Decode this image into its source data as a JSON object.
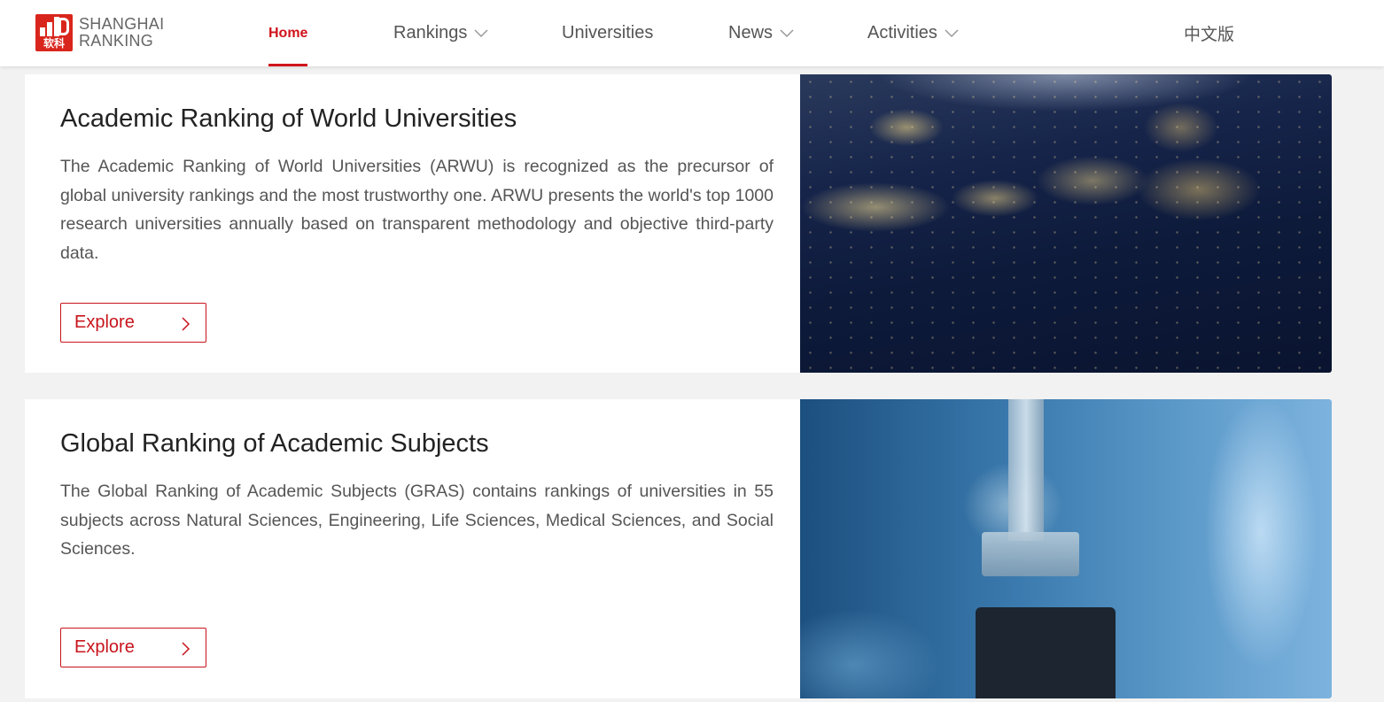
{
  "header": {
    "logo": {
      "line1": "SHANGHAI",
      "line2": "RANKING",
      "mark_text": "软科"
    },
    "nav": [
      {
        "label": "Home",
        "active": true,
        "has_dropdown": false
      },
      {
        "label": "Rankings",
        "active": false,
        "has_dropdown": true
      },
      {
        "label": "Universities",
        "active": false,
        "has_dropdown": false
      },
      {
        "label": "News",
        "active": false,
        "has_dropdown": true
      },
      {
        "label": "Activities",
        "active": false,
        "has_dropdown": true
      }
    ],
    "language": "中文版"
  },
  "cards": [
    {
      "title": "Academic Ranking of World Universities",
      "description": "The Academic Ranking of World Universities (ARWU) is recognized as the precursor of global university rankings and the most trustworthy one. ARWU presents the world's top 1000 research universities annually based on transparent methodology and objective third-party data.",
      "button": "Explore",
      "image": "earth-at-night-image"
    },
    {
      "title": "Global Ranking of Academic Subjects",
      "description": "The Global Ranking of Academic Subjects (GRAS) contains rankings of universities in 55 subjects across Natural Sciences, Engineering, Life Sciences, Medical Sciences, and Social Sciences.",
      "button": "Explore",
      "image": "robotic-arm-image"
    }
  ],
  "colors": {
    "brand_red": "#d0141c",
    "logo_red": "#d9261c",
    "background": "#f2f2f2"
  },
  "icons": {
    "dropdown": "chevron-down-icon",
    "explore": "chevron-right-icon"
  }
}
